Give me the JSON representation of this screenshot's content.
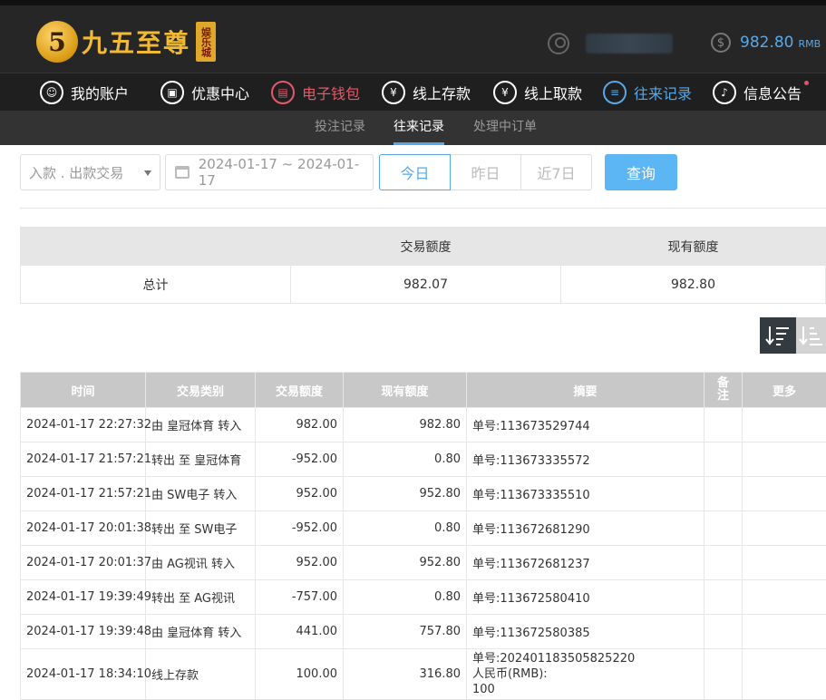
{
  "brand": {
    "name": "九五至尊",
    "badge_char": "5",
    "tag": "娱乐城"
  },
  "header": {
    "balance_value": "982.80",
    "balance_unit": "RMB",
    "dollar_symbol": "$"
  },
  "nav": {
    "items": [
      {
        "label": "我的账户",
        "icon": "user-icon"
      },
      {
        "label": "优惠中心",
        "icon": "gift-icon"
      },
      {
        "label": "电子钱包",
        "icon": "wallet-icon"
      },
      {
        "label": "线上存款",
        "icon": "deposit-icon"
      },
      {
        "label": "线上取款",
        "icon": "withdraw-icon"
      },
      {
        "label": "往来记录",
        "icon": "record-icon"
      },
      {
        "label": "信息公告",
        "icon": "bell-icon"
      }
    ]
  },
  "subnav": {
    "items": [
      "投注记录",
      "往来记录",
      "处理中订单"
    ]
  },
  "filters": {
    "type_select": "入款 . 出款交易",
    "date_range": "2024-01-17 ~ 2024-01-17",
    "quick": [
      "今日",
      "昨日",
      "近7日"
    ],
    "query_label": "查询"
  },
  "summary": {
    "headers": [
      "",
      "交易额度",
      "现有额度"
    ],
    "row": [
      "总计",
      "982.07",
      "982.80"
    ]
  },
  "table": {
    "headers": [
      "时间",
      "交易类别",
      "交易额度",
      "现有额度",
      "摘要",
      "备注",
      "更多"
    ],
    "rows": [
      {
        "time": "2024-01-17 22:27:32",
        "type": "由 皇冠体育 转入",
        "amount": "982.00",
        "balance": "982.80",
        "memo": [
          "单号:113673529744"
        ]
      },
      {
        "time": "2024-01-17 21:57:21",
        "type": "转出 至 皇冠体育",
        "amount": "-952.00",
        "balance": "0.80",
        "memo": [
          "单号:113673335572"
        ]
      },
      {
        "time": "2024-01-17 21:57:21",
        "type": "由 SW电子 转入",
        "amount": "952.00",
        "balance": "952.80",
        "memo": [
          "单号:113673335510"
        ]
      },
      {
        "time": "2024-01-17 20:01:38",
        "type": "转出 至 SW电子",
        "amount": "-952.00",
        "balance": "0.80",
        "memo": [
          "单号:113672681290"
        ]
      },
      {
        "time": "2024-01-17 20:01:37",
        "type": "由 AG视讯 转入",
        "amount": "952.00",
        "balance": "952.80",
        "memo": [
          "单号:113672681237"
        ]
      },
      {
        "time": "2024-01-17 19:39:49",
        "type": "转出 至 AG视讯",
        "amount": "-757.00",
        "balance": "0.80",
        "memo": [
          "单号:113672580410"
        ]
      },
      {
        "time": "2024-01-17 19:39:48",
        "type": "由 皇冠体育 转入",
        "amount": "441.00",
        "balance": "757.80",
        "memo": [
          "单号:113672580385"
        ]
      },
      {
        "time": "2024-01-17 18:34:10",
        "type": "线上存款",
        "amount": "100.00",
        "balance": "316.80",
        "memo": [
          "单号:202401183505825220",
          "人民币(RMB):",
          "100"
        ]
      }
    ]
  },
  "colors": {
    "accent_blue": "#56a8e8",
    "accent_red": "#e55a6a",
    "gold": "#f2b934"
  }
}
